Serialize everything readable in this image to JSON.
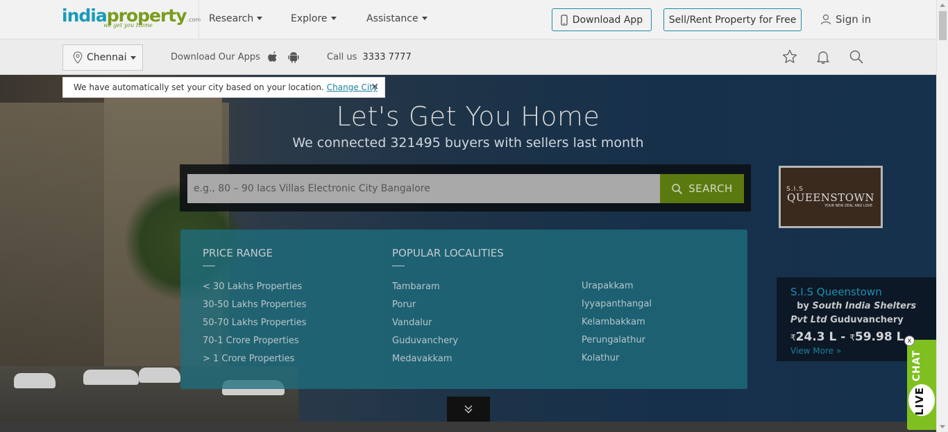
{
  "header": {
    "logo_word1": "india",
    "logo_word2": "property",
    "logo_suffix": ".com",
    "logo_tagline": "we get you Home",
    "nav": [
      {
        "label": "Research"
      },
      {
        "label": "Explore"
      },
      {
        "label": "Assistance"
      }
    ],
    "download_app_label": "Download App",
    "sell_rent_label": "Sell/Rent Property for Free",
    "signin_label": "Sign in"
  },
  "subbar": {
    "city": "Chennai",
    "download_apps_text": "Download Our Apps",
    "call_label": "Call us",
    "call_number": "3333 7777"
  },
  "tooltip": {
    "text": "We have automatically set your city based on your location.",
    "link": "Change City",
    "close": "×"
  },
  "hero": {
    "title": "Let's Get You Home",
    "subtitle": "We connected 321495 buyers with sellers last month",
    "search_placeholder": "e.g., 80 – 90 lacs Villas Electronic City Bangalore",
    "search_button": "SEARCH"
  },
  "panel": {
    "price_heading": "PRICE RANGE",
    "price_links": [
      "< 30 Lakhs Properties",
      "30-50 Lakhs Properties",
      "50-70 Lakhs Properties",
      "70-1 Crore Properties",
      "> 1 Crore Properties"
    ],
    "localities_heading": "POPULAR LOCALITIES",
    "localities_col1": [
      "Tambaram",
      "Porur",
      "Vandalur",
      "Guduvanchery",
      "Medavakkam"
    ],
    "localities_col2": [
      "Urapakkam",
      "Iyyapanthangal",
      "Kelambakkam",
      "Perungalathur",
      "Kolathur"
    ]
  },
  "ad": {
    "line1": "S.I.S",
    "line2": "QUEENSTOWN",
    "line3": "YOUR NEW ZEAL AND LOVE"
  },
  "promo": {
    "name": "S.I.S Queenstown",
    "by": "by",
    "builder": "South India Shelters Pvt Ltd",
    "location": "Guduvanchery",
    "currency": "₹",
    "price_min": "24.3 L",
    "separator": "-",
    "price_max": "59.98 L",
    "view_more": "View More"
  },
  "livechat": {
    "line1": "CHAT",
    "line2": "LIVE",
    "close": "x"
  },
  "colors": {
    "brand_blue": "#1a9bb8",
    "brand_green": "#7a9c1c",
    "search_button": "#5a7a10",
    "panel_teal": "#1e6e7d",
    "livechat_green": "#7fc020"
  }
}
